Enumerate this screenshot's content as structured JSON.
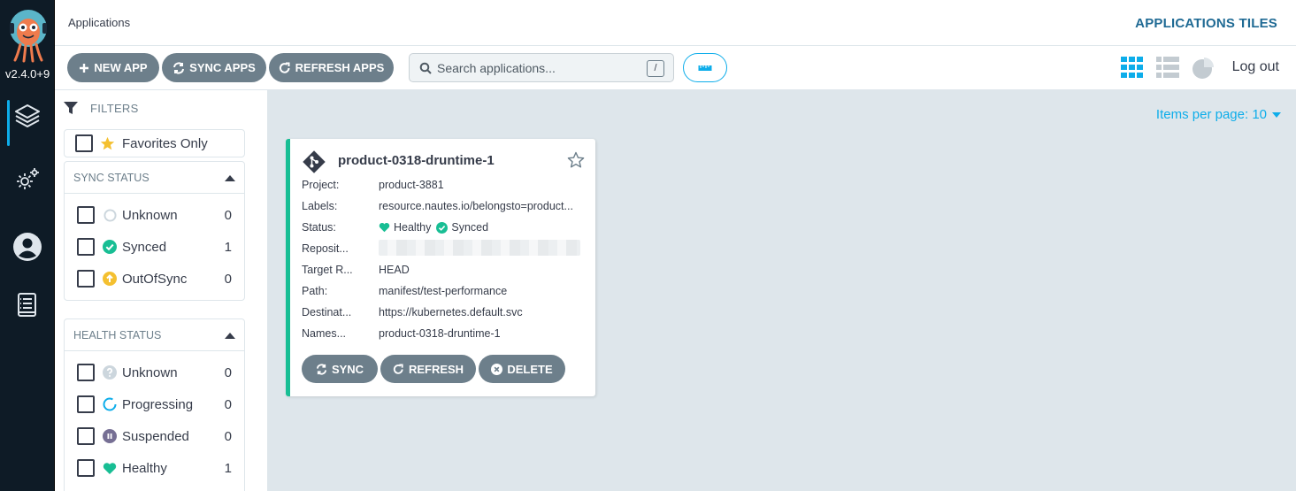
{
  "nav": {
    "version": "v2.4.0+9",
    "items": [
      "applications-nav",
      "settings-nav",
      "user-info-nav",
      "documentation-nav"
    ]
  },
  "header": {
    "title": "Applications",
    "view_title": "APPLICATIONS TILES"
  },
  "toolbar": {
    "new_app": "NEW APP",
    "sync_apps": "SYNC APPS",
    "refresh_apps": "REFRESH APPS",
    "search_placeholder": "Search applications...",
    "search_shortcut": "/",
    "logout": "Log out"
  },
  "filters": {
    "title": "FILTERS",
    "favorites_only": "Favorites Only",
    "sync_status": {
      "title": "SYNC STATUS",
      "items": [
        {
          "label": "Unknown",
          "count": "0"
        },
        {
          "label": "Synced",
          "count": "1"
        },
        {
          "label": "OutOfSync",
          "count": "0"
        }
      ]
    },
    "health_status": {
      "title": "HEALTH STATUS",
      "items": [
        {
          "label": "Unknown",
          "count": "0"
        },
        {
          "label": "Progressing",
          "count": "0"
        },
        {
          "label": "Suspended",
          "count": "0"
        },
        {
          "label": "Healthy",
          "count": "1"
        }
      ]
    }
  },
  "content": {
    "items_per_page": "Items per page: 10"
  },
  "app": {
    "name": "product-0318-druntime-1",
    "fields": [
      {
        "key": "Project:",
        "value": "product-3881"
      },
      {
        "key": "Labels:",
        "value": "resource.nautes.io/belongsto=product..."
      },
      {
        "key": "Status:",
        "health": "Healthy",
        "sync": "Synced"
      },
      {
        "key": "Reposit...",
        "value": ""
      },
      {
        "key": "Target R...",
        "value": "HEAD"
      },
      {
        "key": "Path:",
        "value": "manifest/test-performance"
      },
      {
        "key": "Destinat...",
        "value": "https://kubernetes.default.svc"
      },
      {
        "key": "Names...",
        "value": "product-0318-druntime-1"
      }
    ],
    "actions": {
      "sync": "SYNC",
      "refresh": "REFRESH",
      "delete": "DELETE"
    }
  },
  "colors": {
    "accent": "#0dadea",
    "healthy": "#18be94",
    "out_of_sync": "#f4c030",
    "suspended": "#766f94",
    "button": "#6d7f8b",
    "title_blue": "#1f6a94"
  }
}
